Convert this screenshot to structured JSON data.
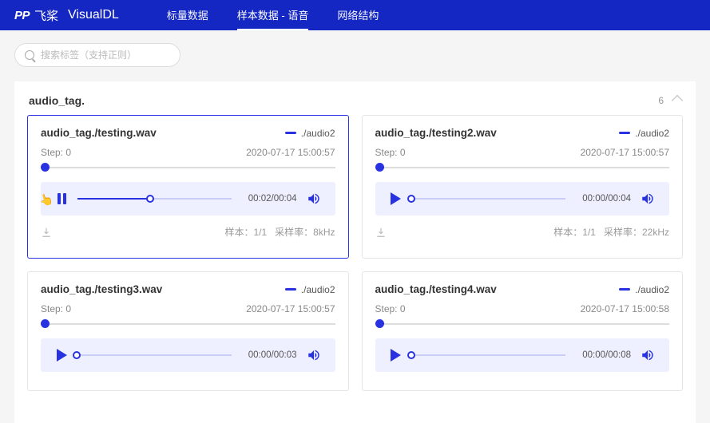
{
  "nav": {
    "brand_prefix": "PP",
    "brand_cn": "飞桨",
    "brand_title": "VisualDL",
    "tabs": [
      "标量数据",
      "样本数据 - 语音",
      "网络结构"
    ],
    "active_tab": 1
  },
  "search": {
    "placeholder": "搜索标签（支持正则）"
  },
  "section": {
    "title": "audio_tag.",
    "count": "6"
  },
  "labels": {
    "step_prefix": "Step: ",
    "sample_prefix": "样本：",
    "rate_prefix": "采样率："
  },
  "cards": [
    {
      "title": "audio_tag./testing.wav",
      "run": "./audio2",
      "step": "0",
      "timestamp": "2020-07-17 15:00:57",
      "playing": true,
      "progress_pct": 48,
      "time": "00:02/00:04",
      "sample": "1/1",
      "rate": "8kHz",
      "active": true,
      "show_footer": true
    },
    {
      "title": "audio_tag./testing2.wav",
      "run": "./audio2",
      "step": "0",
      "timestamp": "2020-07-17 15:00:57",
      "playing": false,
      "progress_pct": 0,
      "time": "00:00/00:04",
      "sample": "1/1",
      "rate": "22kHz",
      "active": false,
      "show_footer": true
    },
    {
      "title": "audio_tag./testing3.wav",
      "run": "./audio2",
      "step": "0",
      "timestamp": "2020-07-17 15:00:57",
      "playing": false,
      "progress_pct": 0,
      "time": "00:00/00:03",
      "sample": "",
      "rate": "",
      "active": false,
      "show_footer": false
    },
    {
      "title": "audio_tag./testing4.wav",
      "run": "./audio2",
      "step": "0",
      "timestamp": "2020-07-17 15:00:58",
      "playing": false,
      "progress_pct": 0,
      "time": "00:00/00:08",
      "sample": "",
      "rate": "",
      "active": false,
      "show_footer": false
    }
  ]
}
